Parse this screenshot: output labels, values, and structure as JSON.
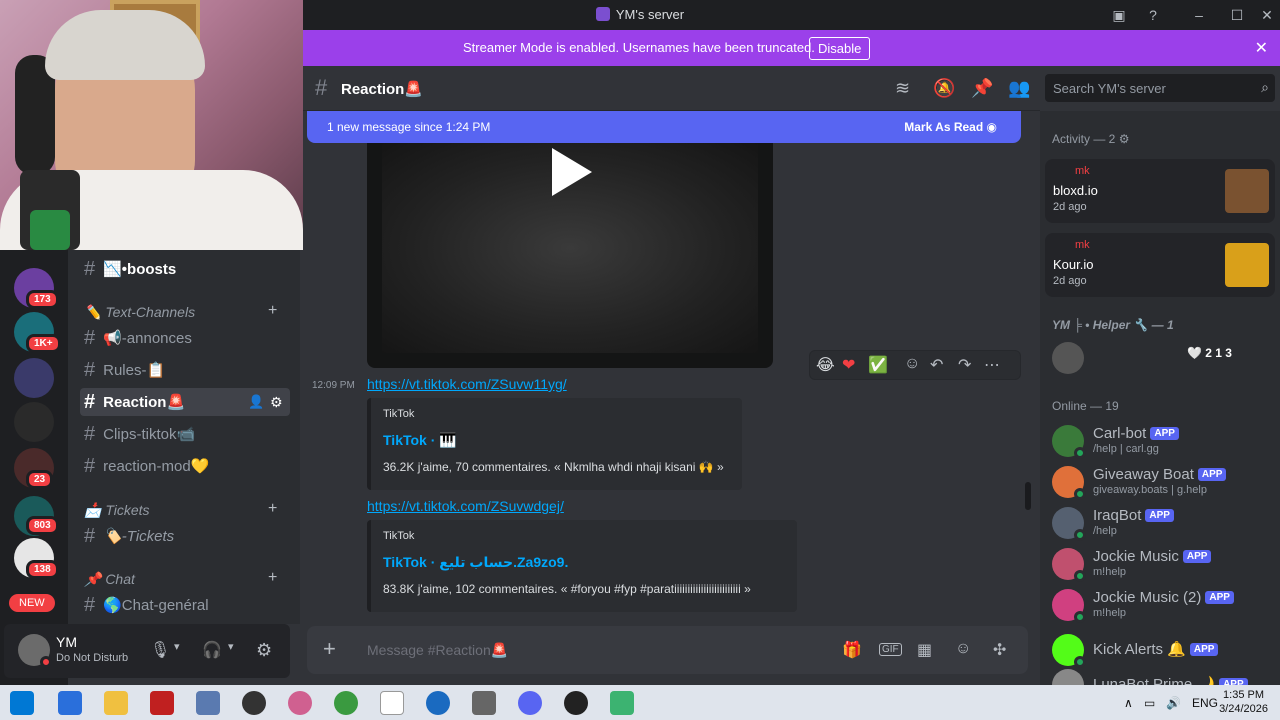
{
  "window": {
    "title": "YM's server"
  },
  "banner": {
    "text": "Streamer Mode is enabled. Usernames have been truncated.",
    "button": "Disable"
  },
  "rail": {
    "badges": [
      "173",
      "1K+",
      "23",
      "803",
      "138"
    ],
    "new_label": "NEW"
  },
  "channels": {
    "items": [
      {
        "label": "📉•boosts"
      },
      {
        "label": "📢-annonces"
      },
      {
        "label": "Rules-📋"
      },
      {
        "label": "Reaction🚨"
      },
      {
        "label": "Clips-tiktok📹"
      },
      {
        "label": "reaction-mod💛"
      },
      {
        "label": "🏷️-Tickets"
      },
      {
        "label": "🌎Chat-genéral"
      }
    ],
    "categories": [
      "✏️ Text-Channels",
      "📩 Tickets",
      "📌 Chat"
    ]
  },
  "user": {
    "name": "YM",
    "status": "Do Not Disturb"
  },
  "header": {
    "channel": "Reaction🚨",
    "search_placeholder": "Search YM's server"
  },
  "newbar": {
    "text": "1 new message since 1:24 PM",
    "action": "Mark As Read"
  },
  "messages": {
    "time": "12:09 PM",
    "link1": "https://vt.tiktok.com/ZSuvw11yg/",
    "embed1": {
      "provider": "TikTok",
      "title": "TikTok · 🎹",
      "desc": "36.2K j'aime, 70 commentaires. « Nkmlha whdi nhaji kisani 🙌 »"
    },
    "link2": "https://vt.tiktok.com/ZSuvwdgej/",
    "embed2": {
      "provider": "TikTok",
      "title": "TikTok · حساب تليع.Za9zo9.",
      "desc": "83.8K j'aime, 102 commentaires. « #foryou #fyp #paratiiiiiiiiiiiiiiiiiiiiiiiii »"
    }
  },
  "composer": {
    "placeholder": "Message #Reaction🚨"
  },
  "members": {
    "activity_header": "Activity — 2",
    "activities": [
      {
        "who": "mk",
        "game": "bloxd.io",
        "ago": "2d ago"
      },
      {
        "who": "mk",
        "game": "Kour.io",
        "ago": "2d ago"
      }
    ],
    "helper_header": "YM ╞ • Helper 🔧 — 1",
    "helper_tag": "🤍 2 1 3",
    "online_header": "Online — 19",
    "list": [
      {
        "name": "Carl-bot",
        "sub": "/help | carl.gg",
        "color": "#3a7a3a"
      },
      {
        "name": "Giveaway Boat",
        "sub": "giveaway.boats | g.help",
        "color": "#e0703a"
      },
      {
        "name": "IraqBot",
        "sub": "/help",
        "color": "#556070"
      },
      {
        "name": "Jockie Music",
        "sub": "m!help",
        "color": "#c0506e"
      },
      {
        "name": "Jockie Music (2)",
        "sub": "m!help",
        "color": "#d04080"
      },
      {
        "name": "Kick Alerts 🔔",
        "sub": "",
        "color": "#53fc18"
      },
      {
        "name": "LunaBot Prime 🌙",
        "sub": "",
        "color": "#888"
      }
    ],
    "app_label": "APP"
  },
  "taskbar": {
    "lang": "ENG",
    "time": "1:35 PM",
    "date": "3/24/2026"
  }
}
